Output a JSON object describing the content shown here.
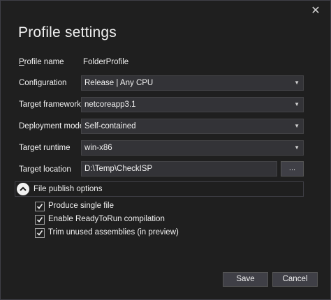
{
  "window": {
    "close_glyph": "✕",
    "title": "Profile settings"
  },
  "fields": {
    "profile_name": {
      "label": "Profile name",
      "value": "FolderProfile"
    },
    "configuration": {
      "label": "Configuration",
      "value": "Release | Any CPU"
    },
    "target_framework": {
      "label": "Target framework",
      "value": "netcoreapp3.1"
    },
    "deployment_mode": {
      "label": "Deployment mode",
      "value": "Self-contained"
    },
    "target_runtime": {
      "label": "Target runtime",
      "value": "win-x86"
    },
    "target_location": {
      "label": "Target location",
      "value": "D:\\Temp\\CheckISP",
      "browse_label": "..."
    }
  },
  "publish_options": {
    "header": "File publish options",
    "expanded": true,
    "items": [
      {
        "label": "Produce single file",
        "checked": true
      },
      {
        "label": "Enable ReadyToRun compilation",
        "checked": true
      },
      {
        "label": "Trim unused assemblies (in preview)",
        "checked": true
      }
    ]
  },
  "buttons": {
    "save": "Save",
    "cancel": "Cancel"
  },
  "icons": {
    "dropdown": "chevron-down-icon",
    "collapse": "chevron-up-icon",
    "check": "checkmark-icon"
  }
}
